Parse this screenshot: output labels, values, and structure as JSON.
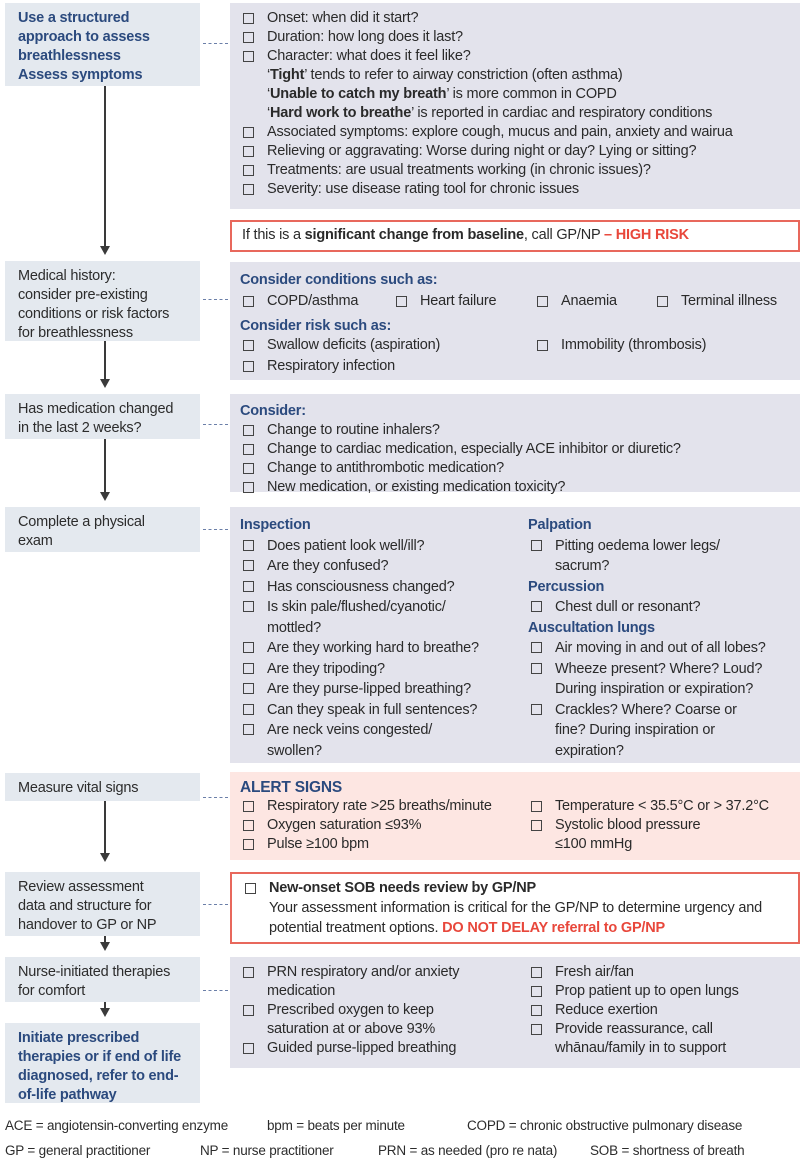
{
  "steps": {
    "assess": {
      "lines": [
        "Use a structured",
        "approach to assess",
        "breathlessness",
        "Assess symptoms"
      ]
    },
    "history": {
      "lines": [
        "Medical history:",
        "consider pre-existing",
        "conditions or risk factors",
        "for breathlessness"
      ]
    },
    "medication": {
      "lines": [
        "Has medication changed",
        "in the last 2 weeks?"
      ]
    },
    "exam": {
      "lines": [
        "Complete a physical",
        "exam"
      ]
    },
    "vitals": {
      "lines": [
        "Measure vital signs"
      ]
    },
    "review": {
      "lines": [
        "Review assessment",
        "data and structure for",
        "handover to GP or NP"
      ]
    },
    "nurse": {
      "lines": [
        "Nurse-initiated therapies",
        "for comfort"
      ]
    },
    "initiate": {
      "lines": [
        "Initiate prescribed",
        "therapies or if end of life",
        "diagnosed, refer to end-",
        "of-life pathway"
      ]
    }
  },
  "symptoms": {
    "items": [
      "Onset: when did it start?",
      "Duration: how long does it last?",
      "Character: what does it feel like?"
    ],
    "character_notes": [
      {
        "bold": "Tight",
        "rest": " tends to refer to airway constriction (often asthma)"
      },
      {
        "bold": "Unable to catch my breath",
        "rest": " is more common in COPD"
      },
      {
        "bold": "Hard work to breathe",
        "rest": " is reported in cardiac and respiratory conditions"
      }
    ],
    "items2": [
      "Associated symptoms: explore cough, mucus and pain, anxiety and wairua",
      "Relieving or aggravating: Worse during night or day? Lying or sitting?",
      "Treatments: are usual treatments working (in chronic issues)?",
      "Severity: use disease rating tool for chronic issues"
    ]
  },
  "high_risk": {
    "prefix": "If this is a ",
    "bold": "significant change from baseline",
    "middle": ", call GP/NP ",
    "alert": "– HIGH RISK"
  },
  "history": {
    "conditions_header": "Consider conditions such as:",
    "conditions": [
      "COPD/asthma",
      "Heart failure",
      "Anaemia",
      "Terminal illness"
    ],
    "risk_header": "Consider risk such as:",
    "risks": [
      "Swallow deficits (aspiration)",
      "Immobility (thrombosis)",
      "Respiratory infection"
    ]
  },
  "medication": {
    "header": "Consider:",
    "items": [
      "Change to routine inhalers?",
      "Change to cardiac medication, especially ACE inhibitor or diuretic?",
      "Change to antithrombotic medication?",
      "New medication, or existing medication toxicity?"
    ]
  },
  "exam": {
    "inspection_header": "Inspection",
    "inspection": [
      "Does patient look well/ill?",
      "Are they confused?",
      "Has consciousness changed?",
      "Is skin pale/flushed/cyanotic/ mottled?",
      "Are they working hard to breathe?",
      "Are they tripoding?",
      "Are they purse-lipped breathing?",
      "Can they speak in full sentences?",
      "Are neck veins congested/ swollen?"
    ],
    "palpation_header": "Palpation",
    "palpation": [
      "Pitting oedema lower legs/ sacrum?"
    ],
    "percussion_header": "Percussion",
    "percussion": [
      "Chest dull or resonant?"
    ],
    "auscultation_header": "Auscultation lungs",
    "auscultation": [
      "Air moving in and out of all lobes?",
      "Wheeze present? Where? Loud? During inspiration or expiration?",
      "Crackles? Where? Coarse or fine? During inspiration or expiration?"
    ]
  },
  "vitals": {
    "header": "ALERT SIGNS",
    "left": [
      "Respiratory rate >25 breaths/minute",
      "Oxygen saturation ≤93%",
      "Pulse ≥100 bpm"
    ],
    "right": [
      "Temperature < 35.5°C or > 37.2°C",
      "Systolic blood pressure ≤100 mmHg"
    ]
  },
  "review": {
    "title": "New-onset SOB needs review by GP/NP",
    "body": "Your assessment information is critical for the GP/NP to determine urgency and potential treatment options. ",
    "alert": "DO NOT DELAY referral to GP/NP"
  },
  "nurse": {
    "left": [
      "PRN respiratory and/or anxiety medication",
      "Prescribed oxygen to keep saturation at or above 93%",
      "Guided purse-lipped breathing"
    ],
    "right": [
      "Fresh air/fan",
      "Prop patient up to open lungs",
      "Reduce exertion",
      "Provide reassurance, call whānau/family in to support"
    ]
  },
  "footnotes": {
    "row1": [
      "ACE = angiotensin-converting enzyme",
      "bpm = beats per minute",
      "COPD = chronic obstructive pulmonary disease"
    ],
    "row2": [
      "GP = general practitioner",
      "NP = nurse practitioner",
      "PRN = as needed (pro re nata)",
      "SOB = shortness of breath"
    ]
  },
  "colors": {
    "step_bg": "#e4e9ef",
    "panel_bg": "#e3e3ec",
    "alert_bg": "#fde6e2",
    "accent_blue": "#2b4a7e",
    "alert_red": "#e8473b"
  }
}
